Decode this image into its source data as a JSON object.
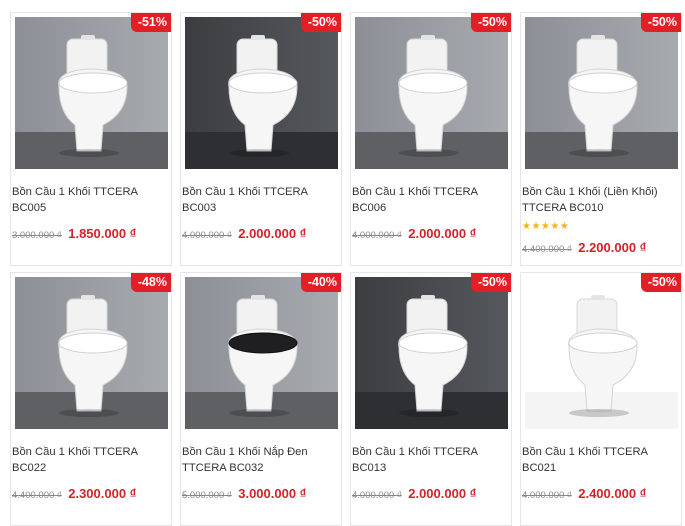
{
  "currency_symbol": "₫",
  "products": [
    {
      "title": "Bồn Cầu 1 Khối TTCERA BC005",
      "old_price": "3.000.000 ₫",
      "new_price": "1.850.000 ₫",
      "discount": "-51%",
      "rating_stars": 0,
      "scene": "gray-wall"
    },
    {
      "title": "Bồn Cầu 1 Khối TTCERA BC003",
      "old_price": "4.000.000 ₫",
      "new_price": "2.000.000 ₫",
      "discount": "-50%",
      "rating_stars": 0,
      "scene": "dark-wall"
    },
    {
      "title": "Bồn Cầu 1 Khối TTCERA BC006",
      "old_price": "4.000.000 ₫",
      "new_price": "2.000.000 ₫",
      "discount": "-50%",
      "rating_stars": 0,
      "scene": "gray-wall"
    },
    {
      "title": "Bồn Cầu 1 Khối (Liền Khối) TTCERA BC010",
      "old_price": "4.400.000 ₫",
      "new_price": "2.200.000 ₫",
      "discount": "-50%",
      "rating_stars": 5,
      "scene": "gray-wall"
    },
    {
      "title": "Bồn Cầu 1 Khối TTCERA BC022",
      "old_price": "4.400.000 ₫",
      "new_price": "2.300.000 ₫",
      "discount": "-48%",
      "rating_stars": 0,
      "scene": "gray-wall"
    },
    {
      "title": "Bồn Cầu 1 Khối Nắp Đen TTCERA BC032",
      "old_price": "5.000.000 ₫",
      "new_price": "3.000.000 ₫",
      "discount": "-40%",
      "rating_stars": 0,
      "scene": "gray-wall"
    },
    {
      "title": "Bồn Cầu 1 Khối TTCERA BC013",
      "old_price": "4.000.000 ₫",
      "new_price": "2.000.000 ₫",
      "discount": "-50%",
      "rating_stars": 0,
      "scene": "dark-wall"
    },
    {
      "title": "Bồn Cầu 1 Khối TTCERA BC021",
      "old_price": "4.000.000 ₫",
      "new_price": "2.400.000 ₫",
      "discount": "-50%",
      "rating_stars": 0,
      "scene": "white"
    }
  ],
  "colors": {
    "badge": "#e31e24",
    "price": "#d2232a",
    "star": "#f6b40e"
  }
}
